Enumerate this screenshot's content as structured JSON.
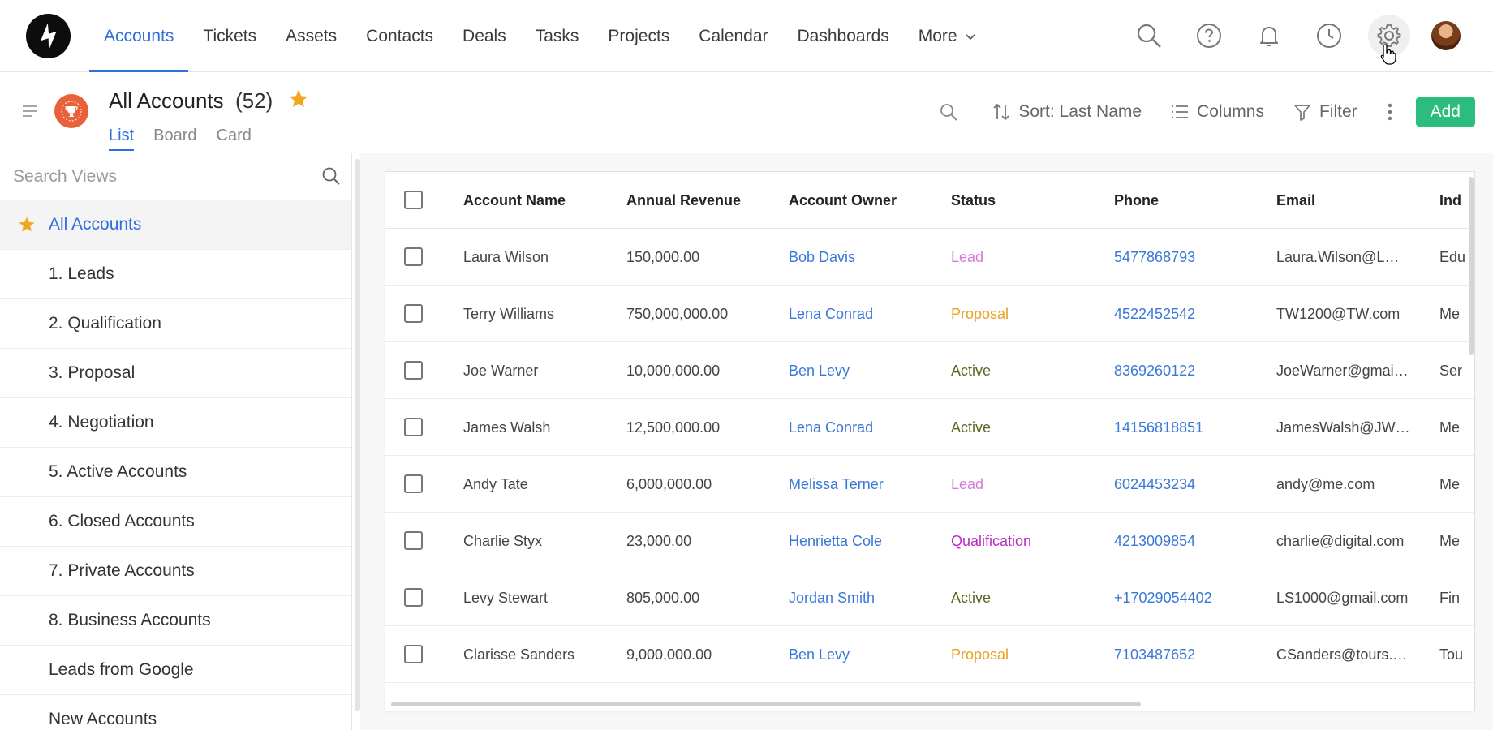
{
  "nav": {
    "links": [
      {
        "label": "Accounts",
        "active": true
      },
      {
        "label": "Tickets"
      },
      {
        "label": "Assets"
      },
      {
        "label": "Contacts"
      },
      {
        "label": "Deals"
      },
      {
        "label": "Tasks"
      },
      {
        "label": "Projects"
      },
      {
        "label": "Calendar"
      },
      {
        "label": "Dashboards"
      },
      {
        "label": "More"
      }
    ],
    "icons": [
      "search-icon",
      "help-icon",
      "bell-icon",
      "clock-icon",
      "gear-icon"
    ]
  },
  "header": {
    "title": "All Accounts",
    "count": "(52)",
    "tabs": [
      "List",
      "Board",
      "Card"
    ],
    "active_tab": "List"
  },
  "toolbar": {
    "sort_label": "Sort: Last Name",
    "columns_label": "Columns",
    "filter_label": "Filter",
    "add_label": "Add"
  },
  "sidebar": {
    "search_placeholder": "Search Views",
    "items": [
      {
        "label": "All Accounts",
        "active": true,
        "starred": true
      },
      {
        "label": "1. Leads"
      },
      {
        "label": "2. Qualification"
      },
      {
        "label": "3. Proposal"
      },
      {
        "label": "4. Negotiation"
      },
      {
        "label": "5. Active Accounts"
      },
      {
        "label": "6. Closed Accounts"
      },
      {
        "label": "7. Private Accounts"
      },
      {
        "label": "8. Business Accounts"
      },
      {
        "label": "Leads from Google"
      },
      {
        "label": "New Accounts"
      }
    ]
  },
  "table": {
    "columns": [
      "Account Name",
      "Annual Revenue",
      "Account Owner",
      "Status",
      "Phone",
      "Email",
      "Ind"
    ],
    "rows": [
      {
        "name": "Laura Wilson",
        "revenue": "150,000.00",
        "owner": "Bob Davis",
        "status": "Lead",
        "phone": "5477868793",
        "email": "Laura.Wilson@L…",
        "industry": "Edu"
      },
      {
        "name": "Terry Williams",
        "revenue": "750,000,000.00",
        "owner": "Lena Conrad",
        "status": "Proposal",
        "phone": "4522452542",
        "email": "TW1200@TW.com",
        "industry": "Me"
      },
      {
        "name": "Joe Warner",
        "revenue": "10,000,000.00",
        "owner": "Ben Levy",
        "status": "Active",
        "phone": "8369260122",
        "email": "JoeWarner@gmai…",
        "industry": "Ser"
      },
      {
        "name": "James Walsh",
        "revenue": "12,500,000.00",
        "owner": "Lena Conrad",
        "status": "Active",
        "phone": "14156818851",
        "email": "JamesWalsh@JW…",
        "industry": "Me"
      },
      {
        "name": "Andy Tate",
        "revenue": "6,000,000.00",
        "owner": "Melissa Terner",
        "status": "Lead",
        "phone": "6024453234",
        "email": "andy@me.com",
        "industry": "Me"
      },
      {
        "name": "Charlie Styx",
        "revenue": "23,000.00",
        "owner": "Henrietta Cole",
        "status": "Qualification",
        "phone": "4213009854",
        "email": "charlie@digital.com",
        "industry": "Me"
      },
      {
        "name": "Levy Stewart",
        "revenue": "805,000.00",
        "owner": "Jordan Smith",
        "status": "Active",
        "phone": "+17029054402",
        "email": "LS1000@gmail.com",
        "industry": "Fin"
      },
      {
        "name": "Clarisse Sanders",
        "revenue": "9,000,000.00",
        "owner": "Ben Levy",
        "status": "Proposal",
        "phone": "7103487652",
        "email": "CSanders@tours.…",
        "industry": "Tou"
      }
    ]
  },
  "colors": {
    "accent": "#2f6fde",
    "add_button": "#2bbd7e",
    "star": "#f0a91f",
    "status_lead": "#d57ad8",
    "status_proposal": "#eaa021",
    "status_active": "#5a6a24",
    "status_qualification": "#bb2bc2"
  }
}
